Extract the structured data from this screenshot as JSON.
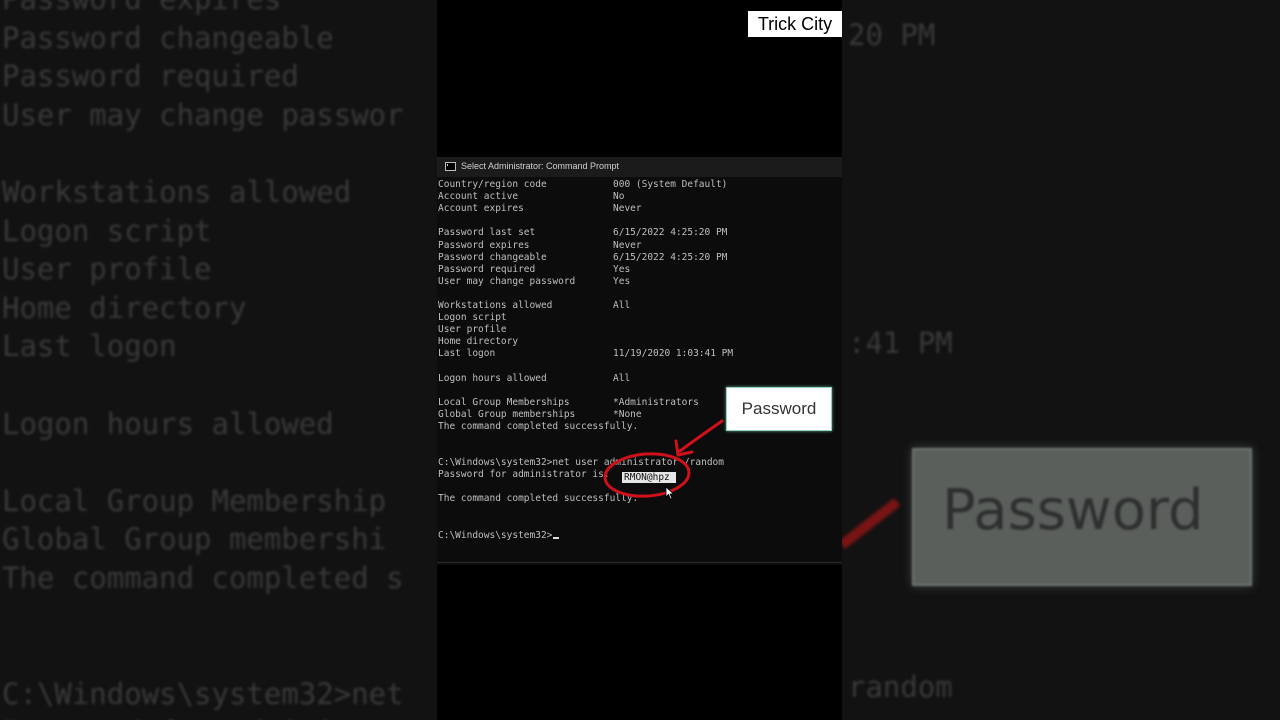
{
  "brand": {
    "label": "Trick City"
  },
  "window": {
    "title": "Select Administrator: Command Prompt"
  },
  "account_fields": [
    {
      "key": "Country/region code",
      "value": "000 (System Default)"
    },
    {
      "key": "Account active",
      "value": "No"
    },
    {
      "key": "Account expires",
      "value": "Never"
    },
    {
      "key": "",
      "value": ""
    },
    {
      "key": "Password last set",
      "value": "6/15/2022 4:25:20 PM"
    },
    {
      "key": "Password expires",
      "value": "Never"
    },
    {
      "key": "Password changeable",
      "value": "6/15/2022 4:25:20 PM"
    },
    {
      "key": "Password required",
      "value": "Yes"
    },
    {
      "key": "User may change password",
      "value": "Yes"
    },
    {
      "key": "",
      "value": ""
    },
    {
      "key": "Workstations allowed",
      "value": "All"
    },
    {
      "key": "Logon script",
      "value": ""
    },
    {
      "key": "User profile",
      "value": ""
    },
    {
      "key": "Home directory",
      "value": ""
    },
    {
      "key": "Last logon",
      "value": "11/19/2020 1:03:41 PM"
    },
    {
      "key": "",
      "value": ""
    },
    {
      "key": "Logon hours allowed",
      "value": "All"
    },
    {
      "key": "",
      "value": ""
    },
    {
      "key": "Local Group Memberships",
      "value": "*Administrators"
    },
    {
      "key": "Global Group memberships",
      "value": "*None"
    }
  ],
  "console": {
    "completed_1": "The command completed successfully.",
    "command": "C:\\Windows\\system32>net user administrator /random",
    "password_prefix": "Password for administrator is:",
    "password_value": "RMON@hpz",
    "completed_2": "The command completed successfully.",
    "prompt": "C:\\Windows\\system32>"
  },
  "annotation": {
    "callout_label": "Password",
    "color": "#d0101a"
  },
  "background": {
    "left_lines": [
      "Password expires",
      "Password changeable",
      "Password required",
      "User may change passwor",
      "",
      "Workstations allowed",
      "Logon script",
      "User profile",
      "Home directory",
      "Last logon",
      "",
      "Logon hours allowed",
      "",
      "Local Group Membership",
      "Global Group membershi",
      "The command completed s",
      "",
      "",
      "C:\\Windows\\system32>net",
      "Password for administrat"
    ],
    "right_fragments": [
      "20 PM",
      ":41 PM",
      "random"
    ],
    "zoom_callout_label": "Password"
  }
}
